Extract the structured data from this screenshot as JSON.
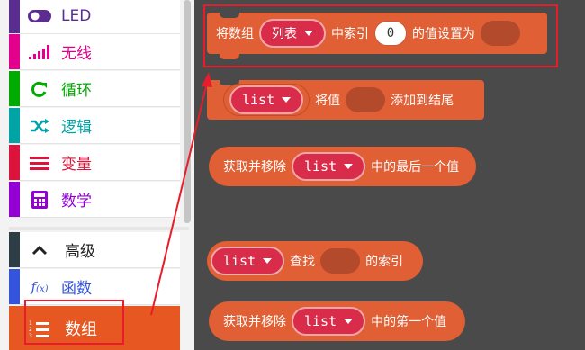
{
  "toolbox": {
    "categories": [
      {
        "label": "LED",
        "icon": "toggle-icon",
        "color": "#5c2d91"
      },
      {
        "label": "无线",
        "icon": "signal-bars-icon",
        "color": "#e3008c"
      },
      {
        "label": "循环",
        "icon": "refresh-icon",
        "color": "#00aa00"
      },
      {
        "label": "逻辑",
        "icon": "shuffle-icon",
        "color": "#00a4a6"
      },
      {
        "label": "变量",
        "icon": "list-lines-icon",
        "color": "#dc143c"
      },
      {
        "label": "数学",
        "icon": "calculator-icon",
        "color": "#9400d3"
      }
    ],
    "advanced": {
      "label": "高级",
      "icon": "chevron-up-icon",
      "color": "#2d3d45"
    },
    "functions": {
      "label": "函数",
      "icon": "function-icon",
      "color": "#3455db"
    },
    "arrays": {
      "label": "数组",
      "icon": "numbered-list-icon",
      "color": "#e65722",
      "selected": true
    }
  },
  "blocks": {
    "set_value": {
      "prefix": "将数组",
      "list_var": "列表",
      "mid": "中索引",
      "index_value": "0",
      "suffix": "的值设置为"
    },
    "add_to_end": {
      "list_var": "list",
      "mid": "将值",
      "suffix": "添加到结尾"
    },
    "remove_last": {
      "prefix": "获取并移除",
      "list_var": "list",
      "suffix": "中的最后一个值"
    },
    "find_index": {
      "list_var": "list",
      "mid": "查找",
      "suffix": "的索引"
    },
    "remove_first": {
      "prefix": "获取并移除",
      "list_var": "list",
      "suffix": "中的第一个值"
    }
  },
  "colors": {
    "block": "#e05f34",
    "dropdown": "#d92b4a",
    "highlight": "#e81c2a",
    "workspace": "#4a4a4a"
  }
}
